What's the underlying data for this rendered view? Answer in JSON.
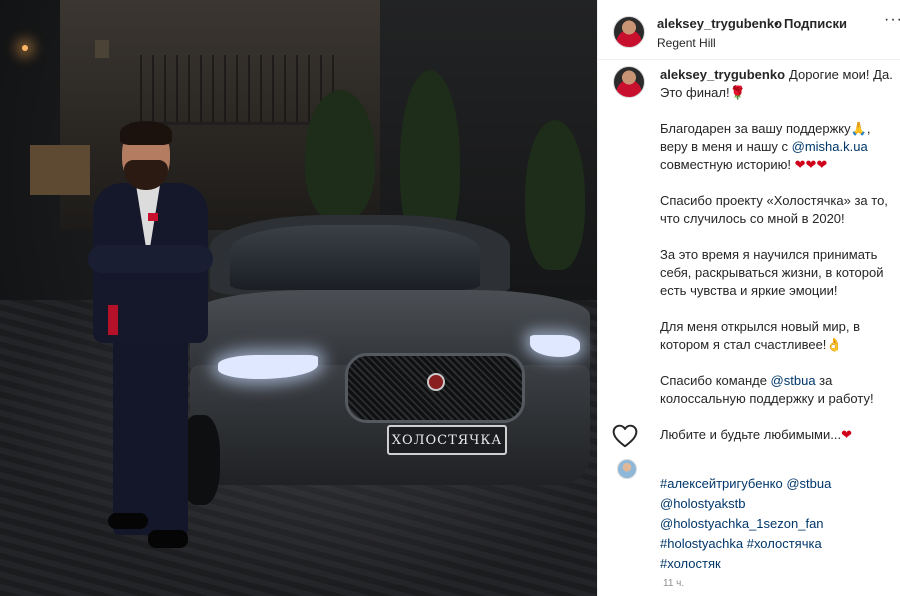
{
  "header": {
    "username": "aleksey_trygubenko",
    "separator": "•",
    "follow_label": "Подписки",
    "location": "Regent Hill",
    "more_label": "···"
  },
  "photo": {
    "plate_text": "ХОЛОСТЯЧКА"
  },
  "caption": {
    "username": "aleksey_trygubenko",
    "p1": "Дорогие мои! Да. Это финал!",
    "p1_emoji": "🌹",
    "p2_a": "Благодарен за вашу поддержку",
    "p2_emoji1": "🙏",
    "p2_b": ", веру в меня и нашу с ",
    "p2_mention": "@misha.k.ua",
    "p2_c": " совместную историю! ",
    "p2_hearts": "❤❤❤",
    "p3": "Спасибо проекту «Холостячка» за то, что случилось со мной в 2020!",
    "p4": "За это время я научился принимать себя, раскрываться жизни, в которой есть чувства и яркие эмоции!",
    "p5": "Для меня открылся новый мир, в котором я стал счастливее!",
    "p5_emoji": "👌",
    "p6_a": "Спасибо команде ",
    "p6_mention": "@stbua",
    "p6_b": " за колоссальную поддержку и работу!",
    "p7": "Любите и будьте любимыми...",
    "p7_heart": "❤"
  },
  "tags": {
    "line1": "#алексейтригубенко @stbua",
    "line2": "@holostyakstb",
    "line3": "@holostyachka_1sezon_fan",
    "line4": "#holostyachka #холостячка",
    "line5": "#холостяк"
  },
  "footer": {
    "time": "11 ч."
  },
  "icons": {
    "like": "heart-outline-icon",
    "more": "more-horizontal-icon"
  },
  "colors": {
    "link": "#00376b",
    "heart": "#d0021b",
    "muted": "#8e8e8e"
  }
}
